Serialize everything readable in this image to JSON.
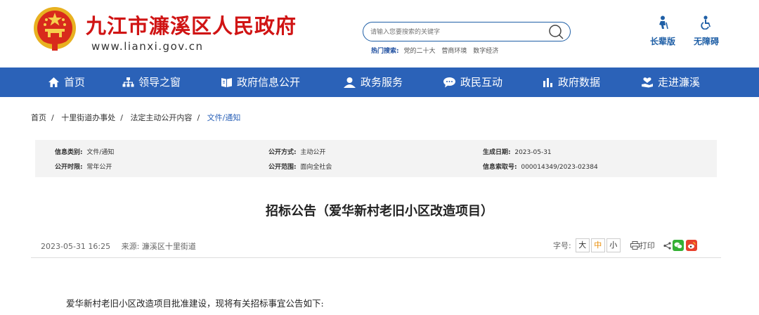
{
  "site": {
    "title": "九江市濂溪区人民政府",
    "url": "www.lianxi.gov.cn"
  },
  "search": {
    "placeholder": "请输入您要搜索的关键字",
    "hot_label": "热门搜索:",
    "hot_items": [
      "党的二十大",
      "营商环境",
      "数字经济"
    ]
  },
  "accessibility": {
    "elder": "长辈版",
    "barrier_free": "无障碍"
  },
  "nav": [
    {
      "label": "首页",
      "icon": "home-icon"
    },
    {
      "label": "领导之窗",
      "icon": "org-chart-icon"
    },
    {
      "label": "政府信息公开",
      "icon": "book-icon"
    },
    {
      "label": "政务服务",
      "icon": "user-service-icon"
    },
    {
      "label": "政民互动",
      "icon": "chat-icon"
    },
    {
      "label": "政府数据",
      "icon": "bar-chart-icon"
    },
    {
      "label": "走进濂溪",
      "icon": "heart-hand-icon"
    }
  ],
  "breadcrumb": [
    "首页",
    "十里街道办事处",
    "法定主动公开内容",
    "文件/通知"
  ],
  "meta": {
    "category_label": "信息类别:",
    "category": "文件/通知",
    "method_label": "公开方式:",
    "method": "主动公开",
    "date_label": "生成日期:",
    "date": "2023-05-31",
    "period_label": "公开时限:",
    "period": "常年公开",
    "scope_label": "公开范围:",
    "scope": "面向全社会",
    "index_label": "信息索取号:",
    "index": "000014349/2023-02384"
  },
  "article": {
    "title": "招标公告（爱华新村老旧小区改造项目）",
    "datetime": "2023-05-31 16:25",
    "source": "来源: 濂溪区十里街道",
    "font_label": "字号:",
    "font_sizes": [
      "大",
      "中",
      "小"
    ],
    "print_label": "打印",
    "body_first_line": "爱华新村老旧小区改造项目批准建设，现将有关招标事宜公告如下:"
  },
  "colors": {
    "brand_red": "#d01414",
    "nav_blue": "#2b62b8",
    "accent_orange": "#e88a00"
  }
}
